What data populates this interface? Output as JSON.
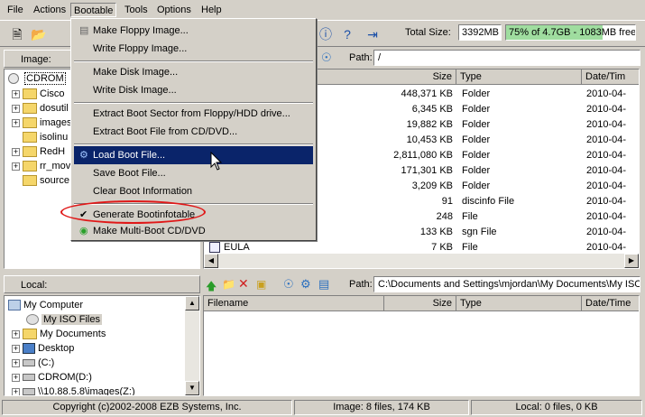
{
  "menubar": [
    "File",
    "Actions",
    "Bootable",
    "Tools",
    "Options",
    "Help"
  ],
  "total_size": {
    "label": "Total Size:",
    "value": "3392MB",
    "bar_text": "75% of 4.7GB - 1083MB free",
    "fill_fraction": 0.75
  },
  "image_panel": {
    "label": "Image:",
    "path_label": "Path:",
    "path": "/"
  },
  "image_tree": [
    "CDROM",
    "Cisco",
    "dosutil",
    "images",
    "isolinu",
    "RedH",
    "rr_mov",
    "source"
  ],
  "file_columns": [
    "Size",
    "Type",
    "Date/Tim"
  ],
  "files": [
    {
      "name": "",
      "size": "448,371 KB",
      "type": "Folder",
      "date": "2010-04-"
    },
    {
      "name": "",
      "size": "6,345 KB",
      "type": "Folder",
      "date": "2010-04-"
    },
    {
      "name": "",
      "size": "19,882 KB",
      "type": "Folder",
      "date": "2010-04-"
    },
    {
      "name": "",
      "size": "10,453 KB",
      "type": "Folder",
      "date": "2010-04-"
    },
    {
      "name": "",
      "size": "2,811,080 KB",
      "type": "Folder",
      "date": "2010-04-"
    },
    {
      "name": "",
      "size": "171,301 KB",
      "type": "Folder",
      "date": "2010-04-"
    },
    {
      "name": "",
      "size": "3,209 KB",
      "type": "Folder",
      "date": "2010-04-"
    },
    {
      "name": "",
      "size": "91",
      "type": "discinfo File",
      "date": "2010-04-"
    },
    {
      "name": "",
      "size": "248",
      "type": "File",
      "date": "2010-04-"
    },
    {
      "name": "",
      "size": "133 KB",
      "type": "sgn File",
      "date": "2010-04-"
    },
    {
      "name": "EULA",
      "size": "7 KB",
      "type": "File",
      "date": "2010-04-"
    }
  ],
  "local_panel": {
    "label": "Local:",
    "path_label": "Path:",
    "path": "C:\\Documents and Settings\\mjordan\\My Documents\\My ISO"
  },
  "local_tree": [
    "My Computer",
    "My ISO Files",
    "My Documents",
    "Desktop",
    "(C:)",
    "CDROM(D:)",
    "\\\\10.88.5.8\\images(Z:)"
  ],
  "local_columns": [
    "Filename",
    "Size",
    "Type",
    "Date/Time"
  ],
  "menu": {
    "items": [
      "Make Floppy Image...",
      "Write Floppy Image...",
      "Make Disk Image...",
      "Write Disk Image...",
      "Extract Boot Sector from Floppy/HDD drive...",
      "Extract Boot File from CD/DVD...",
      "Load Boot File...",
      "Save Boot File...",
      "Clear Boot Information",
      "Generate Bootinfotable",
      "Make Multi-Boot CD/DVD"
    ],
    "highlighted_index": 6,
    "checked_index": 9
  },
  "status": {
    "copyright": "Copyright (c)2002-2008 EZB Systems, Inc.",
    "image": "Image: 8 files, 174 KB",
    "local": "Local: 0 files, 0 KB"
  },
  "colors": {
    "highlight": "#0a246a",
    "bar_fill": "#9fdd9f",
    "annotation": "#e01818"
  }
}
